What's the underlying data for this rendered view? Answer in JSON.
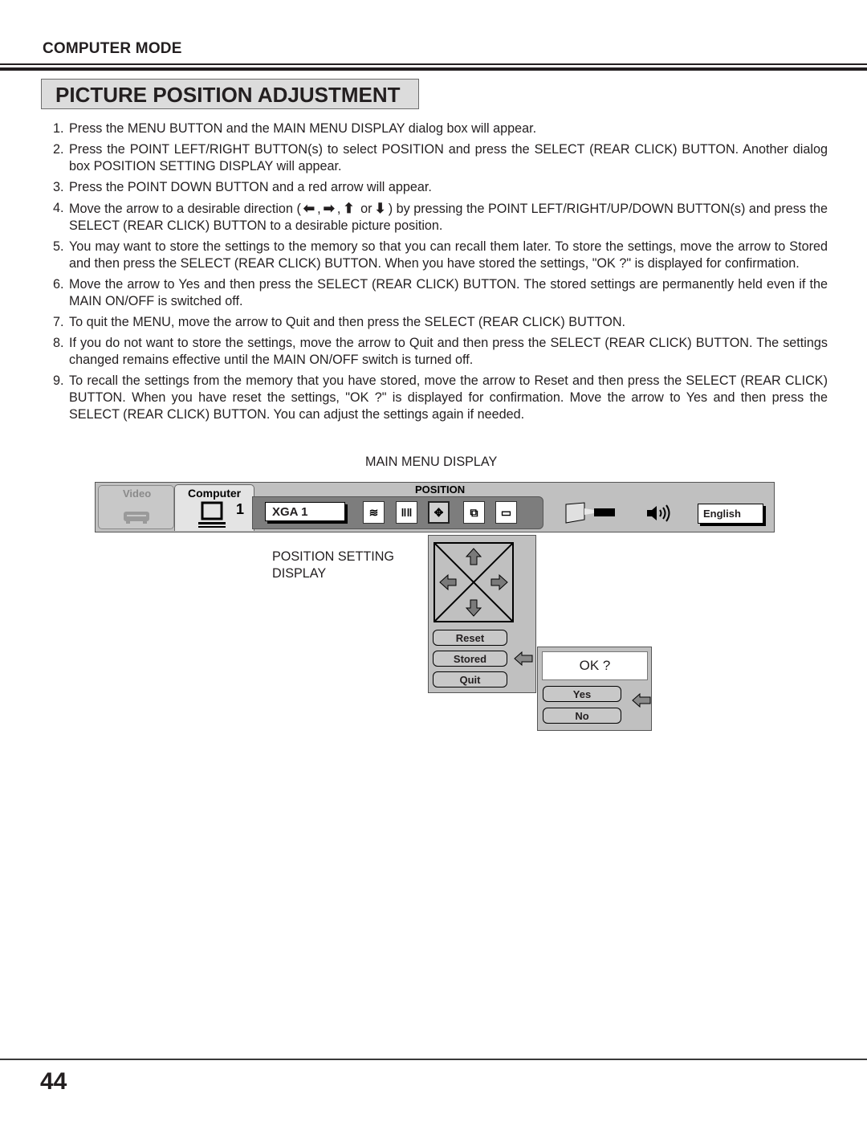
{
  "header": {
    "section": "COMPUTER MODE",
    "title": "PICTURE POSITION ADJUSTMENT"
  },
  "steps": [
    {
      "num": "1.",
      "text": "Press the MENU BUTTON and the MAIN MENU DISPLAY dialog box will appear."
    },
    {
      "num": "2.",
      "text": "Press the POINT LEFT/RIGHT BUTTON(s) to select POSITION and press the SELECT (REAR CLICK) BUTTON. Another dialog box POSITION SETTING DISPLAY will appear."
    },
    {
      "num": "3.",
      "text": "Press the POINT DOWN BUTTON and a red arrow will appear."
    },
    {
      "num": "4.",
      "text_before": "Move the arrow to a desirable direction (",
      "arrows": [
        "⬅",
        "➡",
        "⬆",
        "⬇"
      ],
      "sep": ",",
      "or": "or",
      "text_after": ") by pressing the POINT LEFT/RIGHT/UP/DOWN BUTTON(s) and press the SELECT (REAR CLICK) BUTTON to a desirable picture position."
    },
    {
      "num": "5.",
      "text": "You may want to store the settings to the memory so that you can recall them later. To store the settings, move the arrow to Stored and then press the SELECT (REAR CLICK) BUTTON. When you have stored the settings, \"OK ?\" is displayed for confirmation."
    },
    {
      "num": "6.",
      "text": "Move the arrow to Yes and then press the SELECT (REAR CLICK) BUTTON. The stored settings are permanently held even if the MAIN ON/OFF is switched off."
    },
    {
      "num": "7.",
      "text": "To quit the MENU, move the arrow to Quit and then press the SELECT (REAR CLICK) BUTTON."
    },
    {
      "num": "8.",
      "text": "If you do not want to store the settings, move the arrow to Quit and then press the SELECT (REAR CLICK) BUTTON. The settings changed remains effective until the MAIN ON/OFF switch is turned off."
    },
    {
      "num": "9.",
      "text": "To recall the settings from the memory that you have stored, move the arrow to Reset and then press the SELECT (REAR CLICK) BUTTON. When you have reset the settings, \"OK ?\" is displayed for confirmation. Move the arrow to Yes and then press the SELECT (REAR CLICK) BUTTON. You can adjust the settings again if needed."
    }
  ],
  "captions": {
    "main_menu": "MAIN MENU DISPLAY",
    "position_setting": "POSITION SETTING DISPLAY"
  },
  "main_menu": {
    "tab_video": "Video",
    "tab_computer": "Computer",
    "computer_number": "1",
    "section_title": "POSITION",
    "mode_value": "XGA 1",
    "icons": [
      "fine-sync-icon",
      "total-dots-icon",
      "position-icon",
      "image-adjust-icon",
      "keystone-icon"
    ],
    "selected_icon": "position-icon",
    "language": "English"
  },
  "position_setting": {
    "buttons": [
      "Reset",
      "Stored",
      "Quit"
    ],
    "pointer_on": "Stored"
  },
  "confirm_dialog": {
    "message": "OK ?",
    "buttons": [
      "Yes",
      "No"
    ],
    "pointer_on": "Yes"
  },
  "footer": {
    "page_number": "44"
  }
}
